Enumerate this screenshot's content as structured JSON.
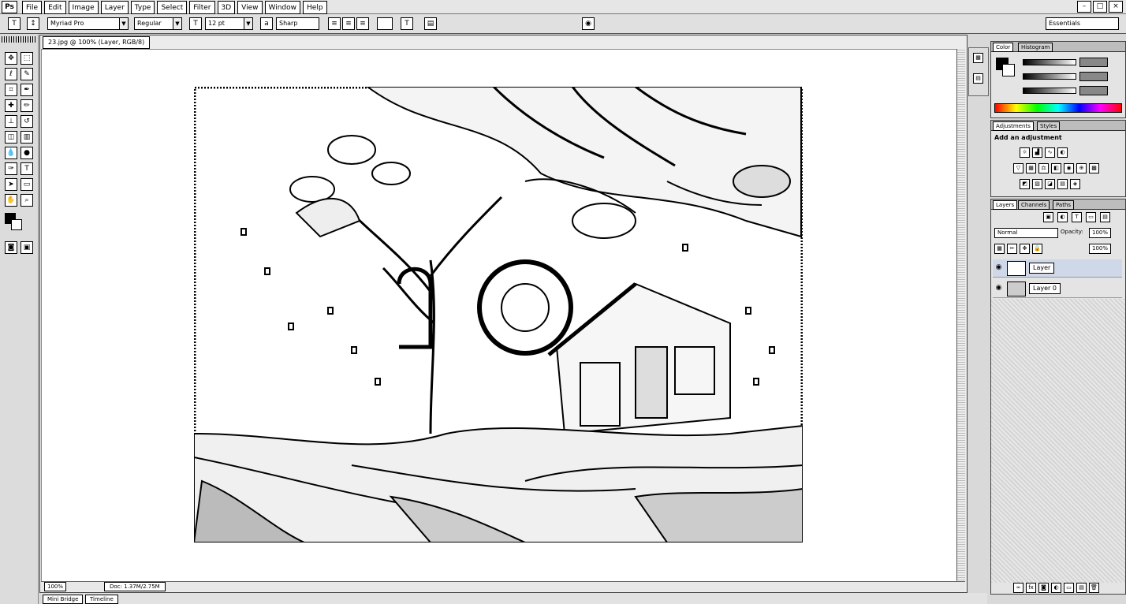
{
  "app": {
    "logo": "Ps",
    "menus": [
      "File",
      "Edit",
      "Image",
      "Layer",
      "Type",
      "Select",
      "Filter",
      "3D",
      "View",
      "Window",
      "Help"
    ],
    "window_controls": [
      "–",
      "□",
      "×"
    ]
  },
  "options_bar": {
    "font_family": "Myriad Pro",
    "font_style": "Regular",
    "font_size": "12 pt",
    "antialias": "Sharp",
    "workspace": "Essentials"
  },
  "document": {
    "tab_title": "23.jpg @ 100% (Layer, RGB/8)",
    "zoom": "100%",
    "doc_info": "Doc: 1.37M/2.75M",
    "bottom_tabs": [
      "Mini Bridge",
      "Timeline"
    ]
  },
  "panels": {
    "navigator_tabs": [
      "Color",
      "Histogram"
    ],
    "adjustments_tabs": [
      "Adjustments",
      "Styles"
    ],
    "adjustments_title": "Add an adjustment",
    "layers_tabs": [
      "Layers",
      "Channels",
      "Paths"
    ],
    "layers_filter": "Normal",
    "opacity_label": "Opacity:",
    "opacity_value": "100%",
    "fill_value": "100%",
    "layers": [
      {
        "name": "Layer",
        "selected": true
      },
      {
        "name": "Layer 0",
        "selected": false
      }
    ]
  }
}
